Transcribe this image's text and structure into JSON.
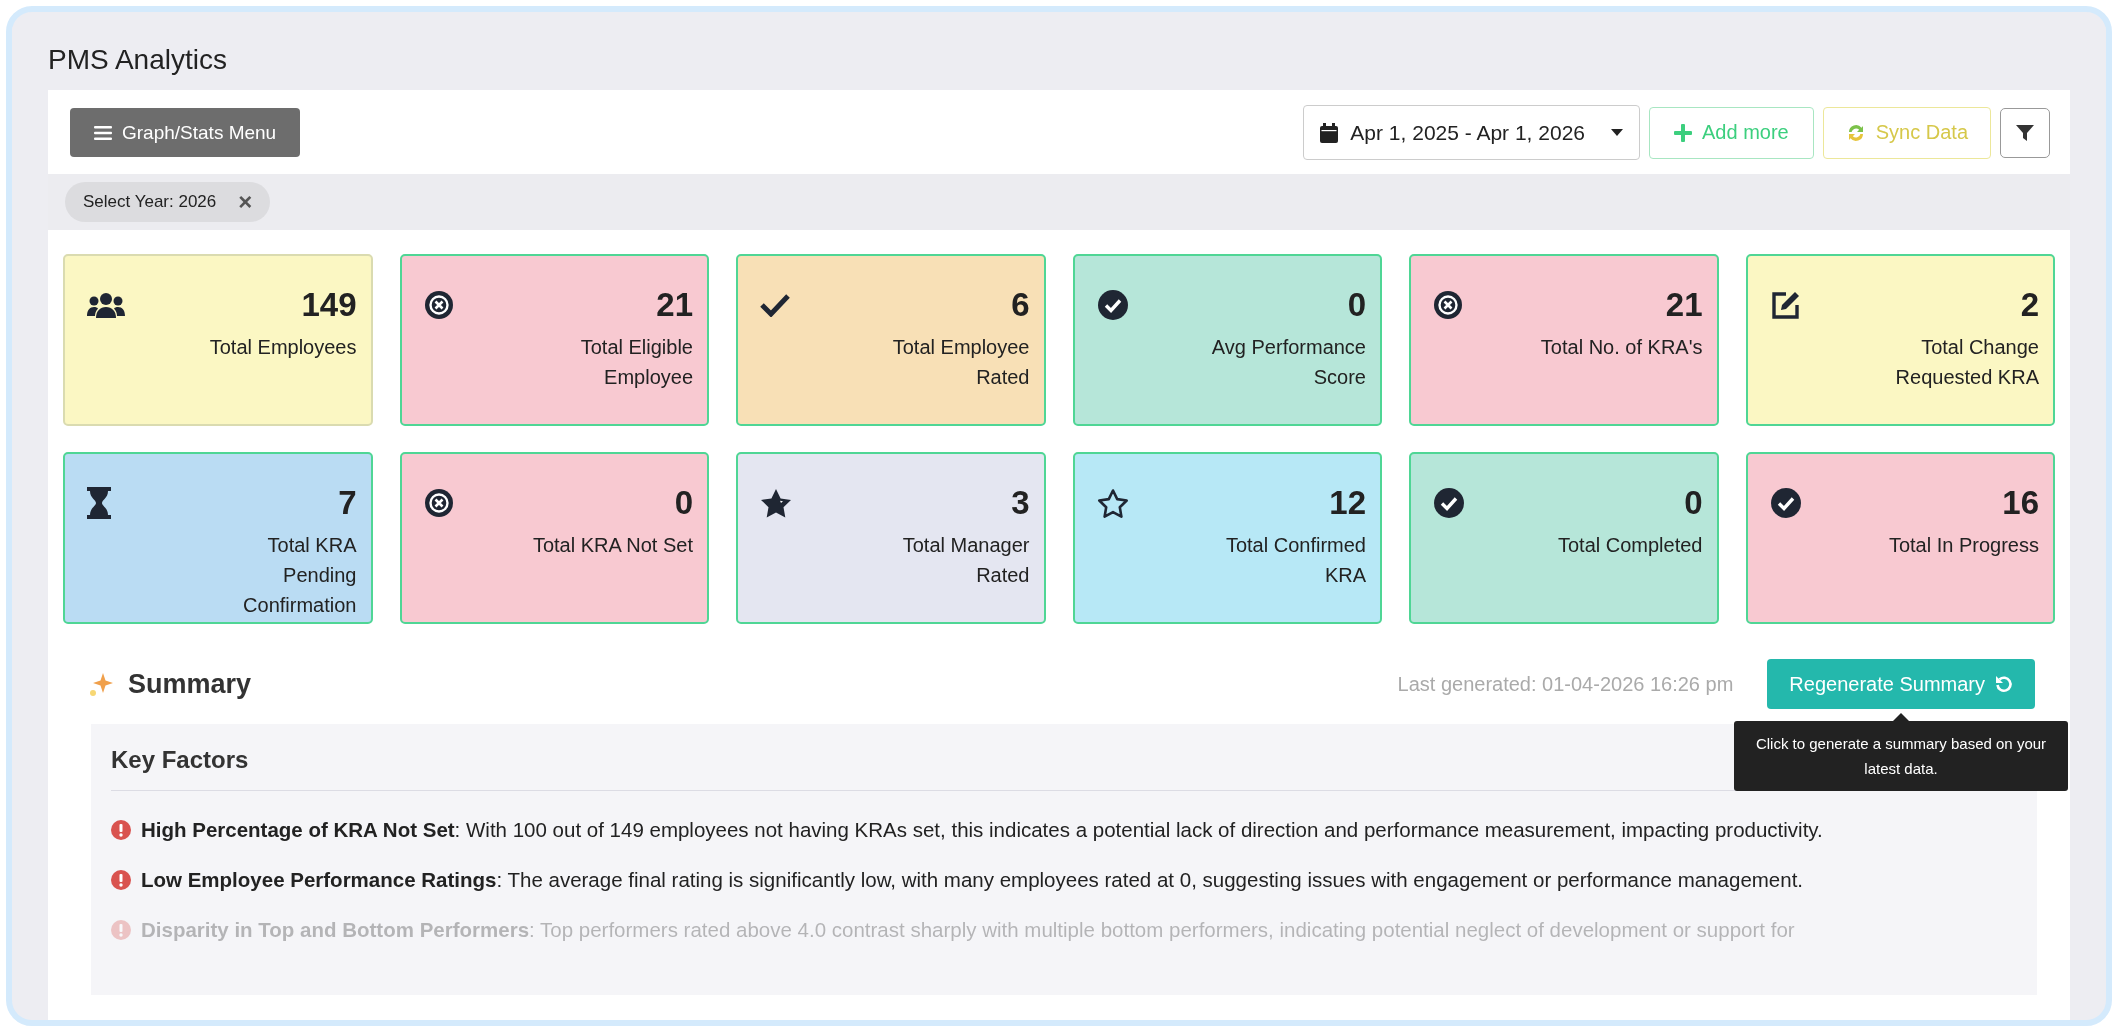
{
  "page_title": "PMS Analytics",
  "toolbar": {
    "menu_button": "Graph/Stats Menu",
    "date_range": "Apr 1, 2025 - Apr 1, 2026",
    "add_button": "Add more",
    "sync_button": "Sync Data"
  },
  "filter_chip": {
    "label": "Select Year: 2026",
    "remove": "×"
  },
  "stat_cards": [
    {
      "kind": "users",
      "value": "149",
      "label": "Total Employees",
      "color": "#fbf7c3"
    },
    {
      "kind": "x-circle",
      "value": "21",
      "label": "Total Eligible Employee",
      "color": "#f8c9d1"
    },
    {
      "kind": "check",
      "value": "6",
      "label": "Total Employee Rated",
      "color": "#f8e0b6"
    },
    {
      "kind": "check-circle",
      "value": "0",
      "label": "Avg Performance Score",
      "color": "#b6e6d9"
    },
    {
      "kind": "x-circle",
      "value": "21",
      "label": "Total No. of KRA's",
      "color": "#f8c9d1"
    },
    {
      "kind": "edit",
      "value": "2",
      "label": "Total Change Requested KRA",
      "color": "#fbf7c3"
    },
    {
      "kind": "hourglass",
      "value": "7",
      "label": "Total KRA Pending Confirmation",
      "color": "#badcf3"
    },
    {
      "kind": "x-circle",
      "value": "0",
      "label": "Total KRA Not Set",
      "color": "#f8c9d1"
    },
    {
      "kind": "star-half",
      "value": "3",
      "label": "Total Manager Rated",
      "color": "#e4e6f1"
    },
    {
      "kind": "star-outline",
      "value": "12",
      "label": "Total Confirmed KRA",
      "color": "#b7e8f6"
    },
    {
      "kind": "check-circle",
      "value": "0",
      "label": "Total Completed",
      "color": "#b6e6d9"
    },
    {
      "kind": "check-circle",
      "value": "16",
      "label": "Total In Progress",
      "color": "#f8c9d1"
    }
  ],
  "summary": {
    "title": "Summary",
    "last_generated": "Last generated: 01-04-2026 16:26 pm",
    "regenerate_button": "Regenerate Summary",
    "tooltip": "Click to generate a summary based on your latest data.",
    "section_title": "Key Factors",
    "factors": [
      {
        "text": "**High Percentage of KRA Not Set**: With 100 out of 149 employees not having KRAs set, this indicates a potential lack of direction and performance measurement, impacting productivity.",
        "faded": false
      },
      {
        "text": "**Low Employee Performance Ratings**: The average final rating is significantly low, with many employees rated at 0, suggesting issues with engagement or performance management.",
        "faded": false
      },
      {
        "text": "**Disparity in Top and Bottom Performers**: Top performers rated above 4.0 contrast sharply with multiple bottom performers, indicating potential neglect of development or support for",
        "faded": true
      }
    ]
  }
}
